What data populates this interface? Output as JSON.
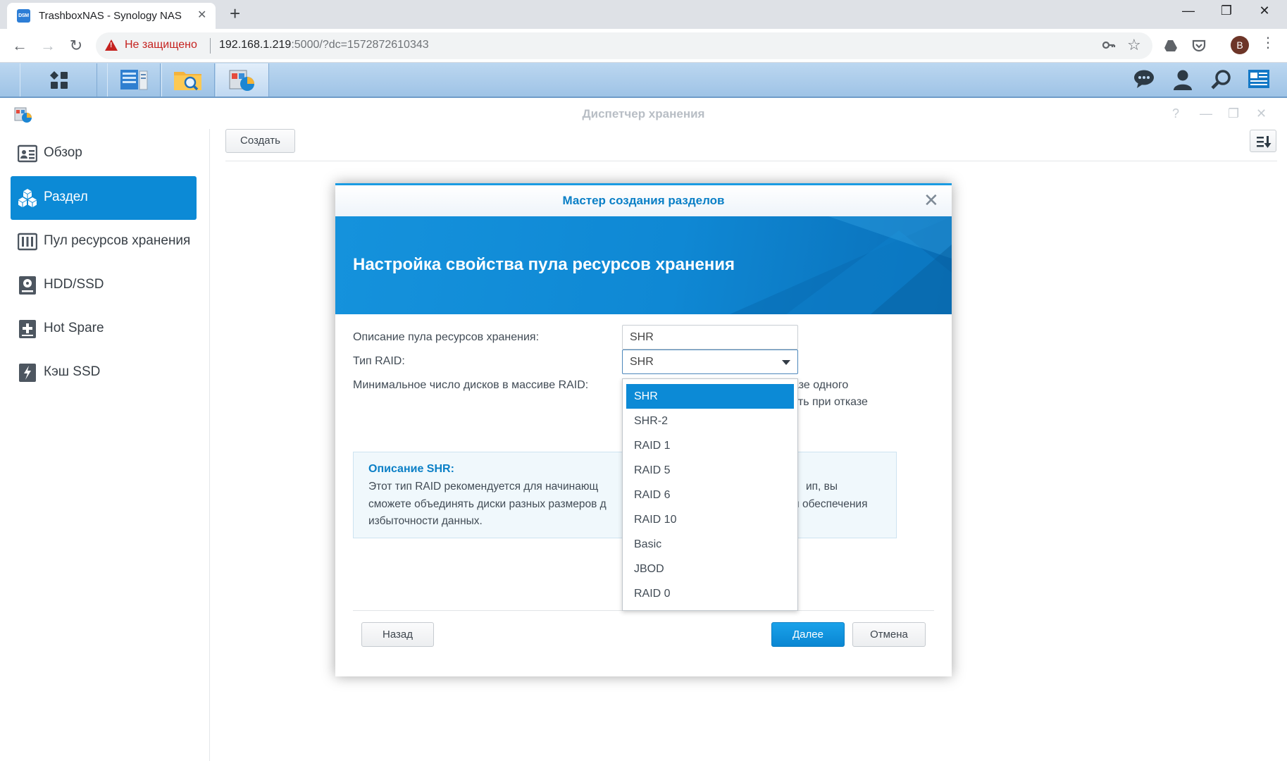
{
  "browser": {
    "tab_title": "TrashboxNAS - Synology NAS",
    "favicon_text": "DSM",
    "new_tab": "+",
    "address": {
      "insecure_label": "Не защищено",
      "host": "192.168.1.219",
      "path": ":5000/?dc=1572872610343"
    },
    "profile_initial": "B",
    "window_controls": {
      "minimize": "—",
      "restore": "❐",
      "close": "✕"
    }
  },
  "app": {
    "title": "Диспетчер хранения",
    "controls": {
      "help": "?",
      "minimize": "—",
      "maximize": "❐",
      "close": "✕"
    }
  },
  "sidebar": {
    "items": [
      {
        "label": "Обзор",
        "icon": "overview-icon"
      },
      {
        "label": "Раздел",
        "icon": "volume-icon",
        "active": true
      },
      {
        "label": "Пул ресурсов хранения",
        "icon": "storage-pool-icon"
      },
      {
        "label": "HDD/SSD",
        "icon": "hdd-icon"
      },
      {
        "label": "Hot Spare",
        "icon": "hot-spare-icon"
      },
      {
        "label": "Кэш SSD",
        "icon": "ssd-cache-icon"
      }
    ]
  },
  "main": {
    "create_label": "Создать"
  },
  "dialog": {
    "title": "Мастер создания разделов",
    "banner_title": "Настройка свойства пула ресурсов хранения",
    "fields": {
      "description_label": "Описание пула ресурсов хранения:",
      "description_value": "SHR",
      "raid_label": "Тип RAID:",
      "raid_value": "SHR",
      "min_disks_label": "Минимальное число дисков в массиве RAID:"
    },
    "hint_line1": "азе одного",
    "hint_line2": "ость при отказе",
    "desc_title": "Описание SHR:",
    "desc_lines": [
      "Этот тип RAID рекомендуется для начинающ",
      "сможете объединять диски разных размеров д",
      "избыточности данных."
    ],
    "desc_right_lines": [
      "ип, вы",
      "и обеспечения"
    ],
    "buttons": {
      "back": "Назад",
      "next": "Далее",
      "cancel": "Отмена"
    },
    "raid_options": [
      "SHR",
      "SHR-2",
      "RAID 1",
      "RAID 5",
      "RAID 6",
      "RAID 10",
      "Basic",
      "JBOD",
      "RAID 0"
    ],
    "raid_selected": "SHR"
  },
  "colors": {
    "accent": "#0c8ad6",
    "dialog_title": "#0a7fc6",
    "insecure": "#c5221f"
  }
}
